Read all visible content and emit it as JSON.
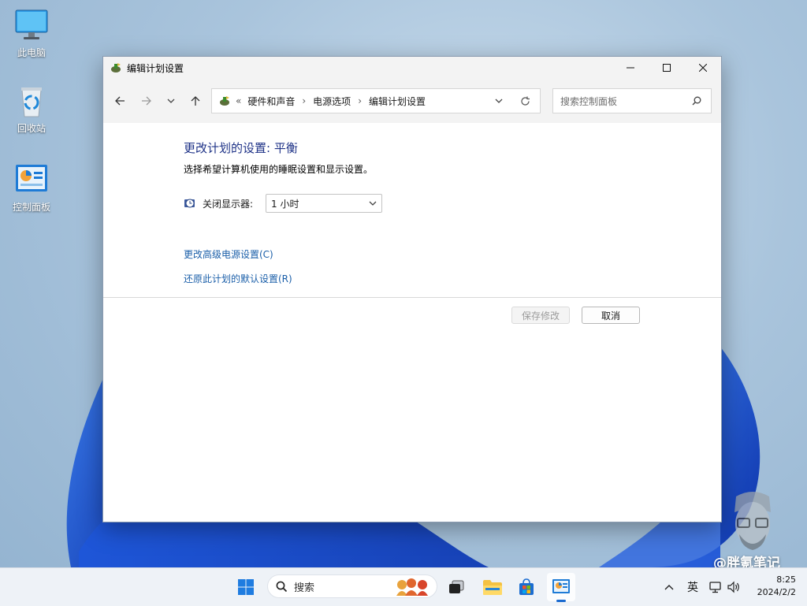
{
  "desktop": {
    "icons": [
      {
        "label": "此电脑",
        "icon": "computer-icon"
      },
      {
        "label": "回收站",
        "icon": "recycle-bin-icon"
      },
      {
        "label": "控制面板",
        "icon": "control-panel-icon"
      }
    ]
  },
  "window": {
    "title": "编辑计划设置",
    "controls": {
      "minimize": "minimize-icon",
      "maximize": "maximize-icon",
      "close": "close-icon"
    },
    "nav": {
      "breadcrumb_overflow": "«",
      "breadcrumbs": [
        "硬件和声音",
        "电源选项",
        "编辑计划设置"
      ],
      "breadcrumb_separator": "›",
      "search_placeholder": "搜索控制面板"
    },
    "content": {
      "heading": "更改计划的设置: 平衡",
      "description": "选择希望计算机使用的睡眠设置和显示设置。",
      "display_off_label": "关闭显示器:",
      "display_off_value": "1 小时",
      "link_advanced": "更改高级电源设置(C)",
      "link_restore": "还原此计划的默认设置(R)",
      "save_button": "保存修改",
      "cancel_button": "取消"
    }
  },
  "watermark": {
    "text": "@胖氪笔记"
  },
  "taskbar": {
    "search_placeholder": "搜索",
    "pinned": [
      "start-icon",
      "task-view-icon",
      "file-explorer-icon",
      "store-icon",
      "control-panel-icon"
    ],
    "active": "control-panel-icon",
    "tray": {
      "ime": "英"
    },
    "clock": {
      "time": "8:25",
      "date": "2024/2/2"
    }
  },
  "colors": {
    "link": "#1b5fa9",
    "heading": "#1e3287",
    "accent": "#1a6ad0"
  }
}
